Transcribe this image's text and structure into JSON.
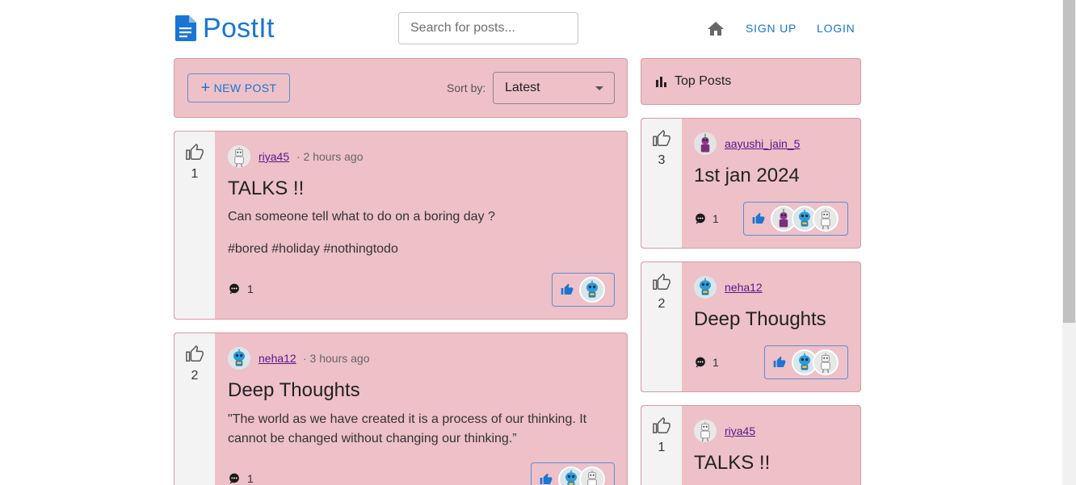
{
  "header": {
    "app_name": "PostIt",
    "search_placeholder": "Search for posts...",
    "signup_label": "SIGN UP",
    "login_label": "LOGIN"
  },
  "toolbar": {
    "new_post_label": "NEW POST",
    "sort_label": "Sort by:",
    "sort_value": "Latest"
  },
  "feed": [
    {
      "likes": "1",
      "username": "riya45",
      "time": "· 2 hours ago",
      "title": "TALKS !!",
      "body": "Can someone tell what to do on a boring day ?",
      "tags": "#bored #holiday #nothingtodo",
      "comments": "1"
    },
    {
      "likes": "2",
      "username": "neha12",
      "time": "· 3 hours ago",
      "title": "Deep Thoughts",
      "body": "\"The world as we have created it is a process of our thinking. It cannot be changed without changing our thinking.”",
      "comments": "1"
    }
  ],
  "top_posts": {
    "title": "Top Posts",
    "items": [
      {
        "likes": "3",
        "username": "aayushi_jain_5",
        "title": "1st jan 2024",
        "comments": "1"
      },
      {
        "likes": "2",
        "username": "neha12",
        "title": "Deep Thoughts",
        "comments": "1"
      },
      {
        "likes": "1",
        "username": "riya45",
        "title": "TALKS !!"
      }
    ]
  },
  "colors": {
    "brand": "#1976d2",
    "card_bg": "#eec0c8",
    "vote_bg": "#f3f3f3"
  }
}
